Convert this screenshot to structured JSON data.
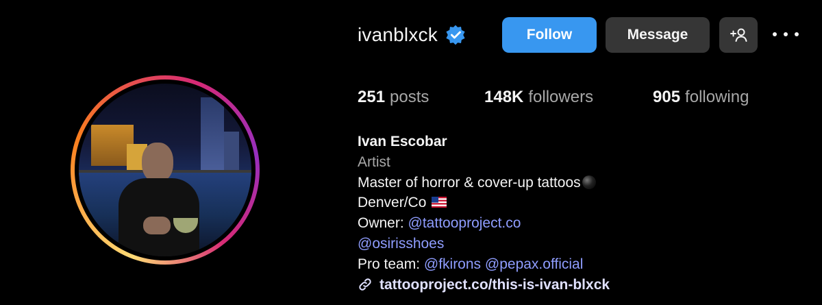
{
  "profile": {
    "username": "ivanblxck",
    "verified_icon": "verified-badge-icon",
    "follow_label": "Follow",
    "message_label": "Message",
    "add_user_icon": "add-person-icon",
    "more_icon": "more-options-icon"
  },
  "stats": {
    "posts_count": "251",
    "posts_label": "posts",
    "followers_count": "148K",
    "followers_label": "followers",
    "following_count": "905",
    "following_label": "following"
  },
  "bio": {
    "full_name": "Ivan Escobar",
    "category": "Artist",
    "line1": "Master of horror & cover-up tattoos",
    "line1_emoji": "black-circle-icon",
    "location": "Denver/Co",
    "location_emoji": "us-flag-icon",
    "owner_prefix": "Owner: ",
    "owner_mention": "@tattooproject.co",
    "mention2": "@osirisshoes",
    "pro_team_prefix": "Pro team: ",
    "pro_team_mention1": "@fkirons",
    "pro_team_mention2": "@pepax.official",
    "link_icon": "link-icon",
    "link": "tattooproject.co/this-is-ivan-blxck"
  },
  "colors": {
    "background": "#000000",
    "follow_button": "#3897f0",
    "secondary_button": "#363636",
    "mention": "#8f9dff",
    "muted_text": "#a8a8a8",
    "verified": "#3897f0"
  }
}
